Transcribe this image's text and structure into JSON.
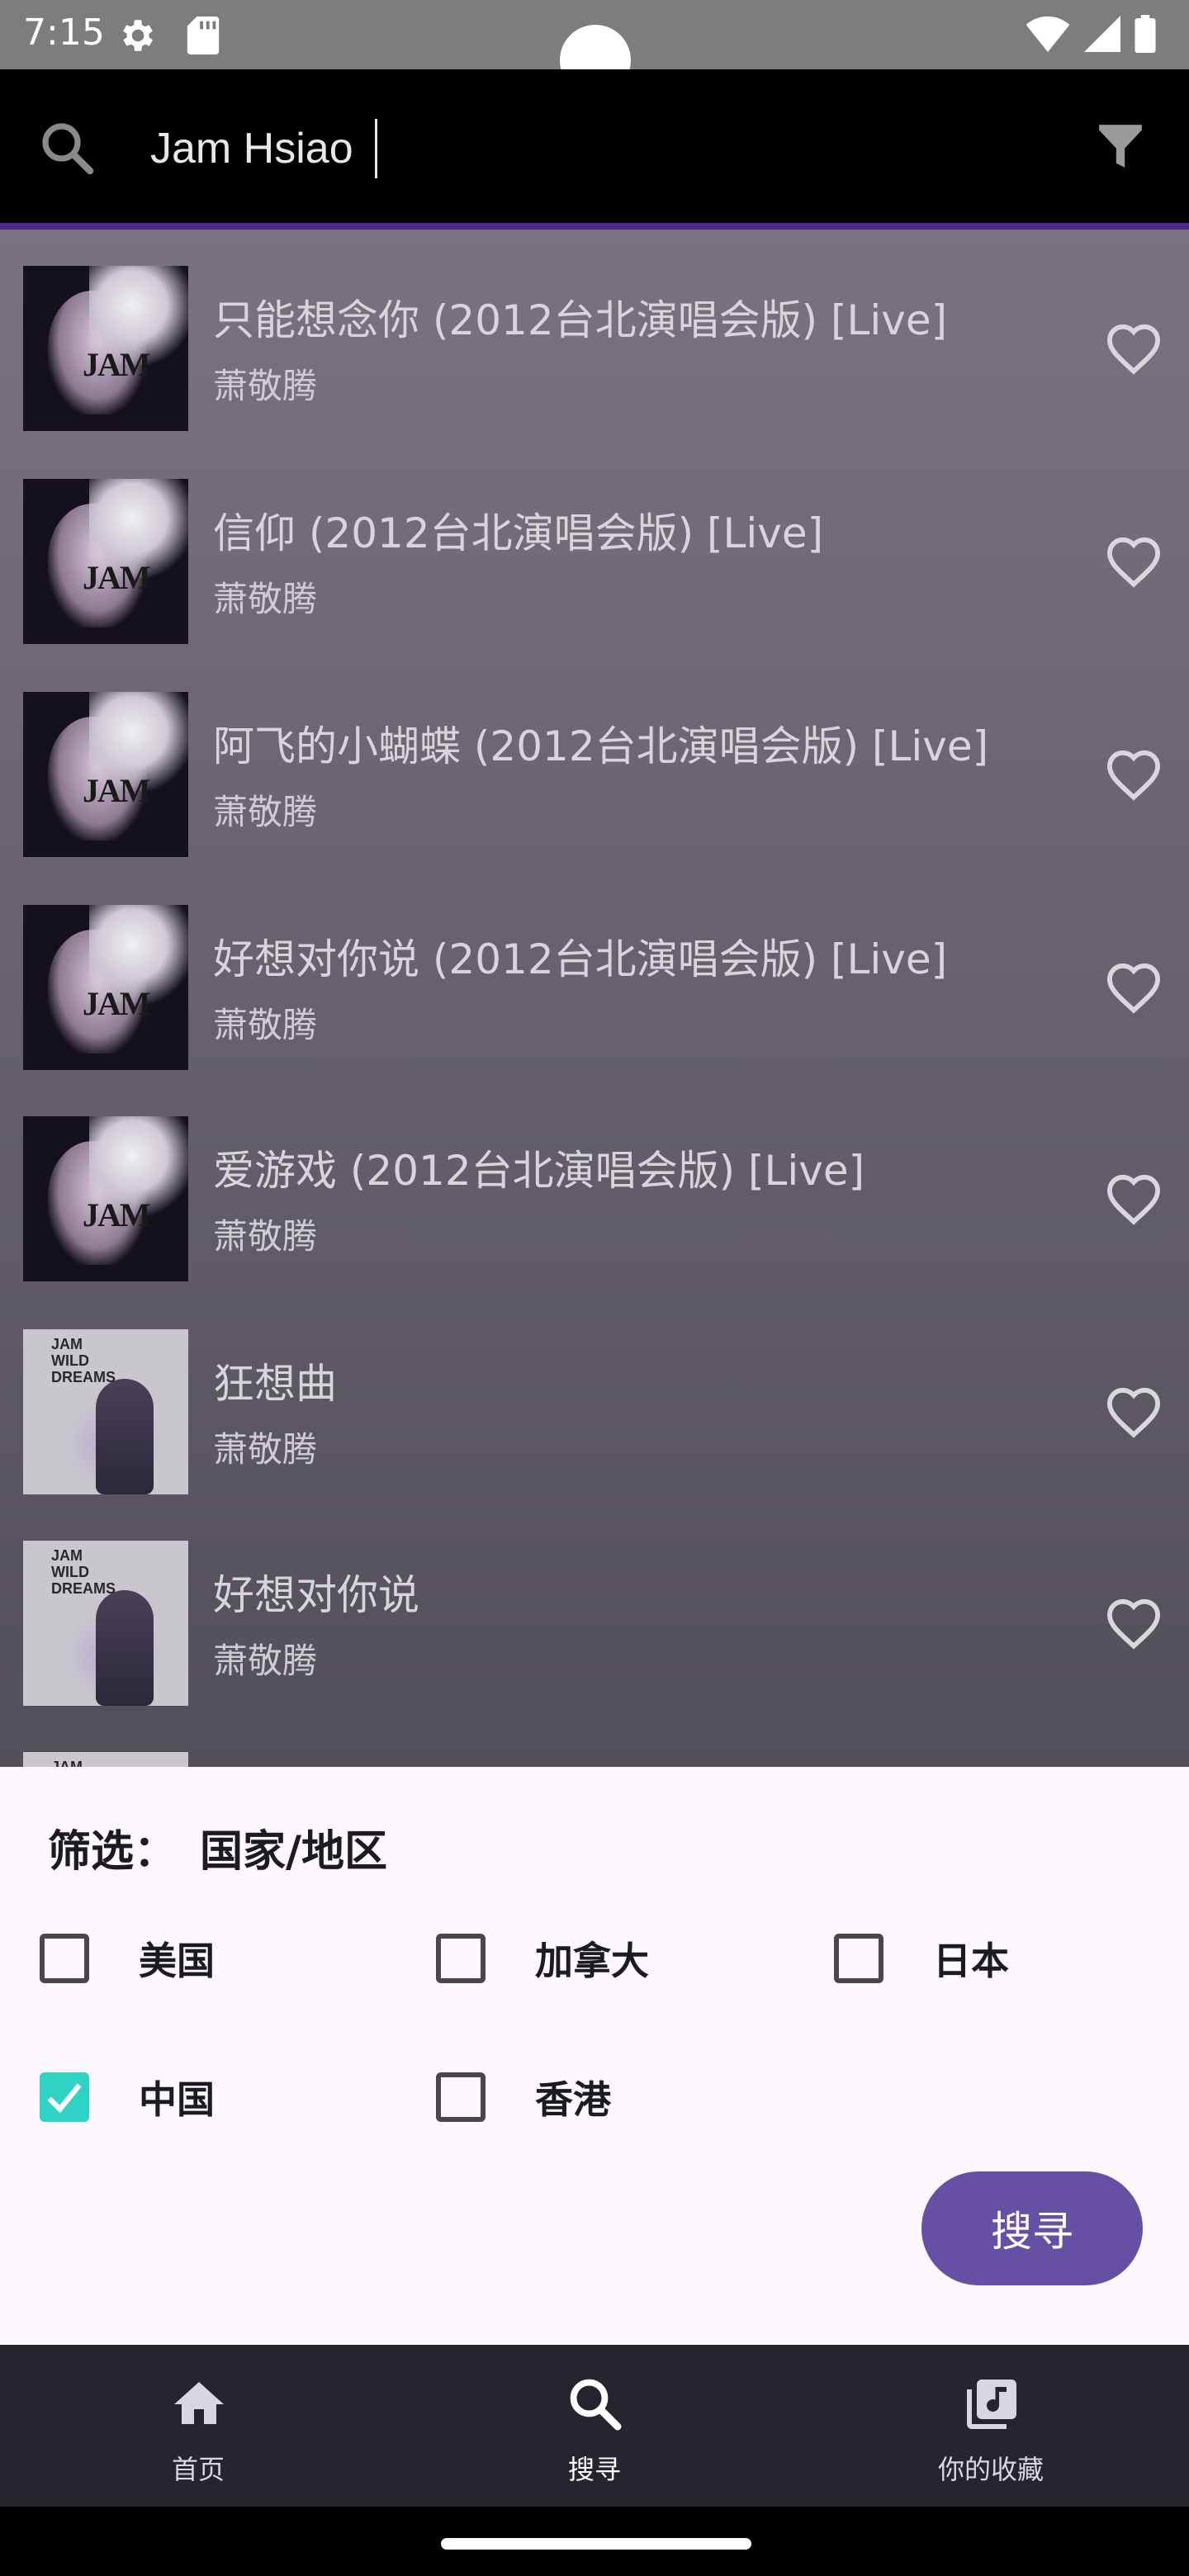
{
  "status_bar": {
    "time": "7:15"
  },
  "search": {
    "query": "Jam Hsiao"
  },
  "songs": [
    {
      "title": "只能想念你 (2012台北演唱会版) [Live]",
      "artist": "萧敬腾",
      "cover": "live"
    },
    {
      "title": "信仰 (2012台北演唱会版) [Live]",
      "artist": "萧敬腾",
      "cover": "live"
    },
    {
      "title": "阿飞的小蝴蝶 (2012台北演唱会版) [Live]",
      "artist": "萧敬腾",
      "cover": "live"
    },
    {
      "title": "好想对你说 (2012台北演唱会版) [Live]",
      "artist": "萧敬腾",
      "cover": "live"
    },
    {
      "title": "爱游戏 (2012台北演唱会版) [Live]",
      "artist": "萧敬腾",
      "cover": "live"
    },
    {
      "title": "狂想曲",
      "artist": "萧敬腾",
      "cover": "wild"
    },
    {
      "title": "好想对你说",
      "artist": "萧敬腾",
      "cover": "wild"
    }
  ],
  "album_covers": {
    "live_text": "JAM",
    "wild_text": "JAM\nWILD\nDREAMS"
  },
  "filter": {
    "label": "筛选：",
    "category": "国家/地区",
    "options": [
      {
        "label": "美国",
        "checked": false
      },
      {
        "label": "加拿大",
        "checked": false
      },
      {
        "label": "日本",
        "checked": false
      },
      {
        "label": "中国",
        "checked": true
      },
      {
        "label": "香港",
        "checked": false
      }
    ],
    "search_button": "搜寻"
  },
  "nav": {
    "items": [
      {
        "label": "首页",
        "icon": "home-icon",
        "active": false
      },
      {
        "label": "搜寻",
        "icon": "search-icon",
        "active": true
      },
      {
        "label": "你的收藏",
        "icon": "library-music-icon",
        "active": false
      }
    ]
  },
  "colors": {
    "accent": "#6650a4",
    "checkbox_checked": "#2ed3c6",
    "header_bg": "#000000",
    "nav_bg": "#26252e",
    "sheet_bg": "#fdf8fd"
  }
}
